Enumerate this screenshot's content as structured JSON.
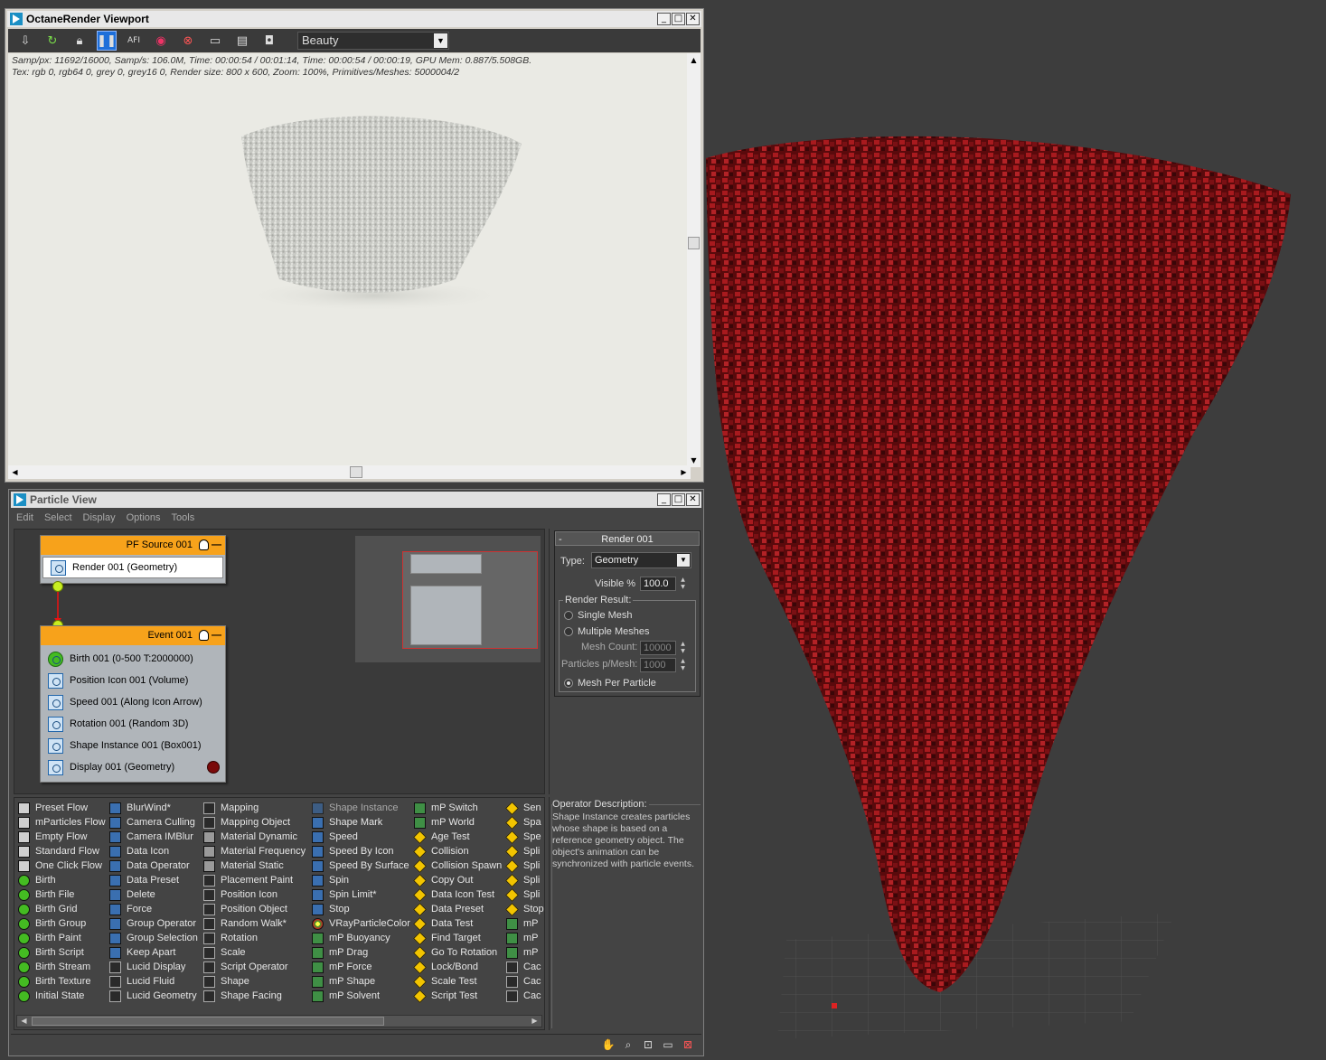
{
  "octane": {
    "title": "OctaneRender Viewport",
    "render_pass": "Beauty",
    "stats_line1": "Samp/px: 11692/16000,   Samp/s: 106.0M,   Time: 00:00:54 / 00:01:14,   Time: 00:00:54 / 00:00:19,   GPU Mem: 0.887/5.508GB.",
    "stats_line2": "Tex: rgb 0, rgb64 0, grey 0, grey16 0,   Render size: 800 x 600,   Zoom: 100%,   Primitives/Meshes: 5000004/2",
    "toolbar_icons": [
      "send-scene-icon",
      "refresh-icon",
      "lock-icon",
      "pause-icon",
      "afi-icon",
      "color-picker-icon",
      "focus-picker-icon",
      "region-render-icon",
      "film-settings-icon",
      "save-image-icon"
    ],
    "afi_label": "AFI"
  },
  "pview": {
    "title": "Particle View",
    "menu": [
      "Edit",
      "Select",
      "Display",
      "Options",
      "Tools"
    ],
    "source_node": {
      "title": "PF Source 001",
      "operators": [
        "Render 001 (Geometry)"
      ]
    },
    "event_node": {
      "title": "Event 001",
      "operators": [
        "Birth 001 (0-500 T:2000000)",
        "Position Icon 001 (Volume)",
        "Speed 001 (Along Icon Arrow)",
        "Rotation 001 (Random 3D)",
        "Shape Instance 001 (Box001)",
        "Display 001 (Geometry)"
      ]
    },
    "params": {
      "rollout_title": "Render 001",
      "rollout_toggle": "-",
      "type_label": "Type:",
      "type_value": "Geometry",
      "visible_label": "Visible %",
      "visible_value": "100.0",
      "render_result_label": "Render Result:",
      "single_mesh": "Single Mesh",
      "multiple_meshes": "Multiple Meshes",
      "mesh_count_label": "Mesh Count:",
      "mesh_count_value": "10000",
      "particles_per_mesh_label": "Particles p/Mesh:",
      "particles_per_mesh_value": "1000",
      "mesh_per_particle": "Mesh Per Particle",
      "selected_result": "Mesh Per Particle"
    },
    "depot": {
      "col1": [
        "Preset Flow",
        "mParticles Flow",
        "Empty Flow",
        "Standard Flow",
        "One Click Flow",
        "Birth",
        "Birth File",
        "Birth Grid",
        "Birth Group",
        "Birth Paint",
        "Birth Script",
        "Birth Stream",
        "Birth Texture",
        "Initial State"
      ],
      "col2": [
        "BlurWind*",
        "Camera Culling",
        "Camera IMBlur",
        "Data Icon",
        "Data Operator",
        "Data Preset",
        "Delete",
        "Force",
        "Group Operator",
        "Group Selection",
        "Keep Apart",
        "Lucid Display",
        "Lucid Fluid",
        "Lucid Geometry"
      ],
      "col3": [
        "Mapping",
        "Mapping Object",
        "Material Dynamic",
        "Material Frequency",
        "Material Static",
        "Placement Paint",
        "Position Icon",
        "Position Object",
        "Random Walk*",
        "Rotation",
        "Scale",
        "Script Operator",
        "Shape",
        "Shape Facing"
      ],
      "col4": [
        "Shape Instance",
        "Shape Mark",
        "Speed",
        "Speed By Icon",
        "Speed By Surface",
        "Spin",
        "Spin Limit*",
        "Stop",
        "VRayParticleColor",
        "mP Buoyancy",
        "mP Drag",
        "mP Force",
        "mP Shape",
        "mP Solvent"
      ],
      "col5": [
        "mP Switch",
        "mP World",
        "Age Test",
        "Collision",
        "Collision Spawn",
        "Copy Out",
        "Data Icon Test",
        "Data Preset",
        "Data Test",
        "Find Target",
        "Go To Rotation",
        "Lock/Bond",
        "Scale Test",
        "Script Test"
      ],
      "col6": [
        "Sen",
        "Spa",
        "Spe",
        "Spli",
        "Spli",
        "Spli",
        "Spli",
        "Stop",
        "mP",
        "mP",
        "mP",
        "Cac",
        "Cac",
        "Cac"
      ],
      "selected": "Shape Instance"
    },
    "description": {
      "title": "Operator Description:",
      "text": "Shape Instance creates particles whose shape is based on a reference geometry object. The object's animation can be synchronized with particle events."
    }
  },
  "colors": {
    "accent_blue": "#1e6fd9",
    "node_header": "#f7a21b",
    "particle_red": "#8a0f12",
    "port_green": "#c8ee20"
  }
}
